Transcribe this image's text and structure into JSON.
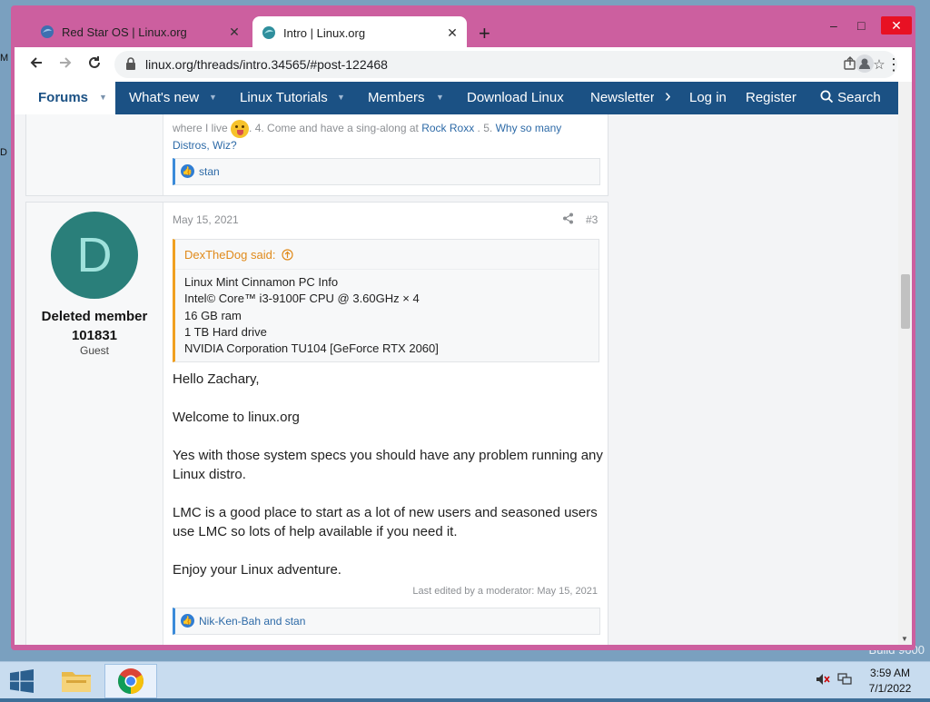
{
  "desktop": {
    "left_glyph_1": "M",
    "left_glyph_2": "D",
    "watermark": "Build 9600"
  },
  "browser": {
    "tabs": [
      {
        "title": "Red Star OS | Linux.org",
        "active": false
      },
      {
        "title": "Intro | Linux.org",
        "active": true
      }
    ],
    "new_tab_label": "+",
    "window_controls": {
      "minimize": "–",
      "maximize": "□",
      "close": "✕"
    },
    "url": "linux.org/threads/intro.34565/#post-122468",
    "icons": [
      "back-icon",
      "forward-icon",
      "reload-icon",
      "lock-icon",
      "share-icon",
      "star-icon",
      "profile-icon",
      "menu-icon"
    ]
  },
  "site_nav": {
    "forums": "Forums",
    "items": [
      "What's new",
      "Linux Tutorials",
      "Members",
      "Download Linux",
      "Newsletter"
    ],
    "more_chevron": "›",
    "login": "Log in",
    "register": "Register",
    "search": "Search",
    "colors": {
      "nav_bg": "#1b5184",
      "accent": "#2d6aa7"
    }
  },
  "post_prev": {
    "text_a": "where I live",
    "text_b": ". 4. Come and have a sing-along at",
    "link_1": "Rock Roxx",
    "text_c": ". 5.",
    "link_2": "Why so many Distros, Wiz?",
    "reactions": "stan"
  },
  "post": {
    "avatar_letter": "D",
    "author_line1": "Deleted member",
    "author_line2": "101831",
    "user_title": "Guest",
    "date": "May 15, 2021",
    "number": "#3",
    "quote": {
      "author": "DexTheDog said:",
      "lines": [
        "Linux Mint Cinnamon PC Info",
        "Intel© Core™ i3-9100F CPU @ 3.60GHz × 4",
        "16 GB ram",
        "1 TB Hard drive",
        "NVIDIA Corporation TU104 [GeForce RTX 2060]"
      ]
    },
    "paragraphs": [
      "Hello Zachary,",
      "Welcome to linux.org",
      "Yes with those system specs you should have any problem running any Linux distro.",
      "LMC is a good place to start as a lot of new users and seasoned users use LMC so lots of help available if you need it.",
      "Enjoy your Linux adventure."
    ],
    "edited": "Last edited by a moderator: May 15, 2021",
    "reactions": "Nik-Ken-Bah and stan"
  },
  "taskbar": {
    "time": "3:59 AM",
    "date": "7/1/2022"
  }
}
